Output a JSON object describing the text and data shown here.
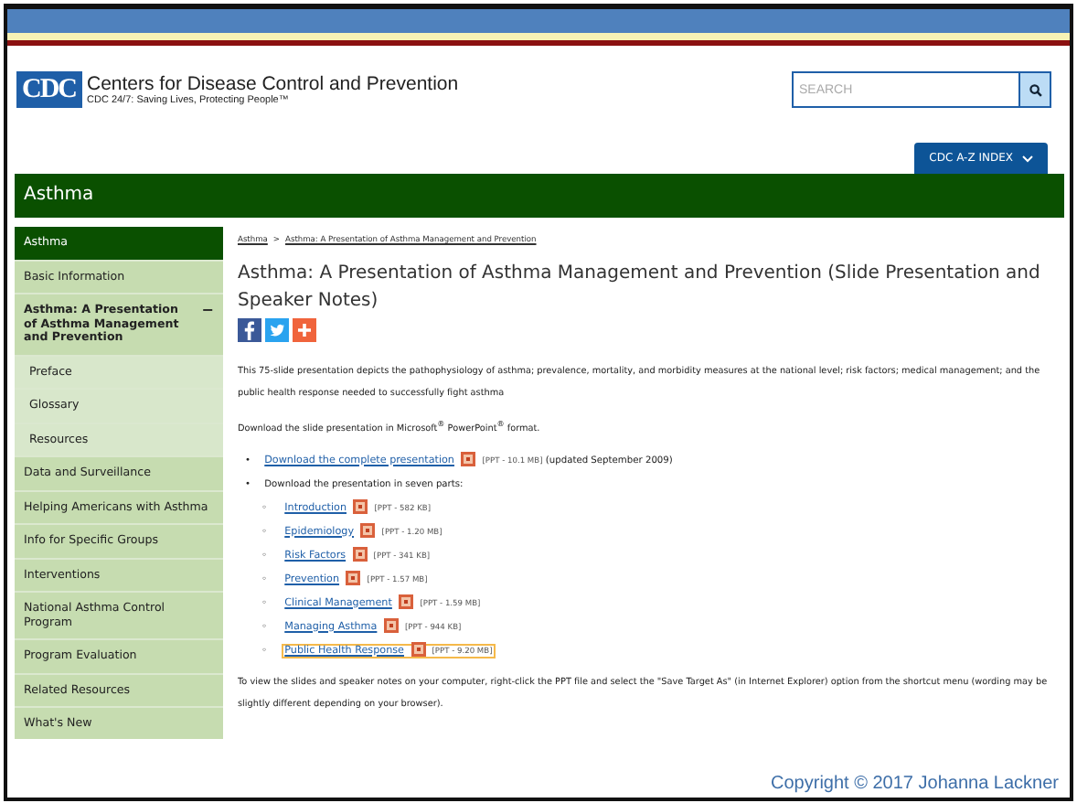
{
  "header": {
    "logo": "CDC",
    "org_name": "Centers for Disease Control and Prevention",
    "tagline": "CDC 24/7: Saving Lives, Protecting People™",
    "search": {
      "placeholder": "SEARCH"
    },
    "az_index": "CDC A-Z INDEX"
  },
  "banner": "Asthma",
  "sidebar": {
    "items": [
      {
        "label": "Asthma",
        "selected": true,
        "expanded": false
      },
      {
        "label": "Basic Information",
        "selected": false,
        "expanded": false
      },
      {
        "label": "Asthma: A Presentation of Asthma Management and Prevention",
        "selected": false,
        "expanded": true,
        "toggle": "−",
        "children": [
          {
            "label": "Preface",
            "selected": false
          },
          {
            "label": "Glossary",
            "selected": false
          },
          {
            "label": "Resources",
            "selected": false
          }
        ]
      },
      {
        "label": "Data and Surveillance",
        "selected": false,
        "expanded": false
      },
      {
        "label": "Helping Americans with Asthma",
        "selected": false,
        "expanded": false
      },
      {
        "label": "Info for Specific Groups",
        "selected": false,
        "expanded": false
      },
      {
        "label": "Interventions",
        "selected": false,
        "expanded": false
      },
      {
        "label": "National Asthma Control Program",
        "selected": false,
        "expanded": false
      },
      {
        "label": "Program Evaluation",
        "selected": false,
        "expanded": false
      },
      {
        "label": "Related Resources",
        "selected": false,
        "expanded": false
      },
      {
        "label": "What's New",
        "selected": false,
        "expanded": false
      }
    ]
  },
  "breadcrumb": {
    "items": [
      "Asthma",
      "Asthma: A Presentation of Asthma Management and Prevention"
    ],
    "separator": ">"
  },
  "title": "Asthma: A Presentation of Asthma Management and Prevention (Slide Presentation and Speaker Notes)",
  "share_buttons": [
    {
      "kind": "facebook"
    },
    {
      "kind": "twitter"
    },
    {
      "kind": "plus"
    }
  ],
  "intro": "This 75-slide presentation depicts the pathophysiology of asthma; prevalence, mortality, and morbidity measures at the national level; risk factors; medical management; and the public health response needed to successfully fight asthma",
  "download_note": "Download the slide presentation in Microsoft$^{®}$ PowerPoint$^{®}$ format.",
  "downloads": [
    {
      "bullet": "•",
      "link": "Download the complete presentation",
      "size": "[PPT - 10.1 MB]",
      "note": "(updated September 2009)"
    },
    {
      "bullet": "•",
      "text": "Download the presentation in seven parts:",
      "part_bullet": "◦",
      "parts": [
        {
          "link": "Introduction",
          "size": "[PPT - 582 KB]",
          "focused": false
        },
        {
          "link": "Epidemiology",
          "size": "[PPT - 1.20 MB]",
          "focused": false
        },
        {
          "link": "Risk Factors",
          "size": "[PPT - 341 KB]",
          "focused": false
        },
        {
          "link": "Prevention",
          "size": "[PPT - 1.57 MB]",
          "focused": false
        },
        {
          "link": "Clinical Management",
          "size": "[PPT - 1.59 MB]",
          "focused": false
        },
        {
          "link": "Managing Asthma",
          "size": "[PPT - 944 KB]",
          "focused": false
        },
        {
          "link": "Public Health Response",
          "size": "[PPT - 9.20 MB]",
          "focused": true
        }
      ]
    }
  ],
  "instructions": "To view the slides and speaker notes on your computer, right-click the PPT file and select the \"Save Target As\" (in Internet Explorer) option from the shortcut menu (wording may be slightly different depending on your browser).",
  "copyright": "Copyright © 2017 Johanna Lackner"
}
